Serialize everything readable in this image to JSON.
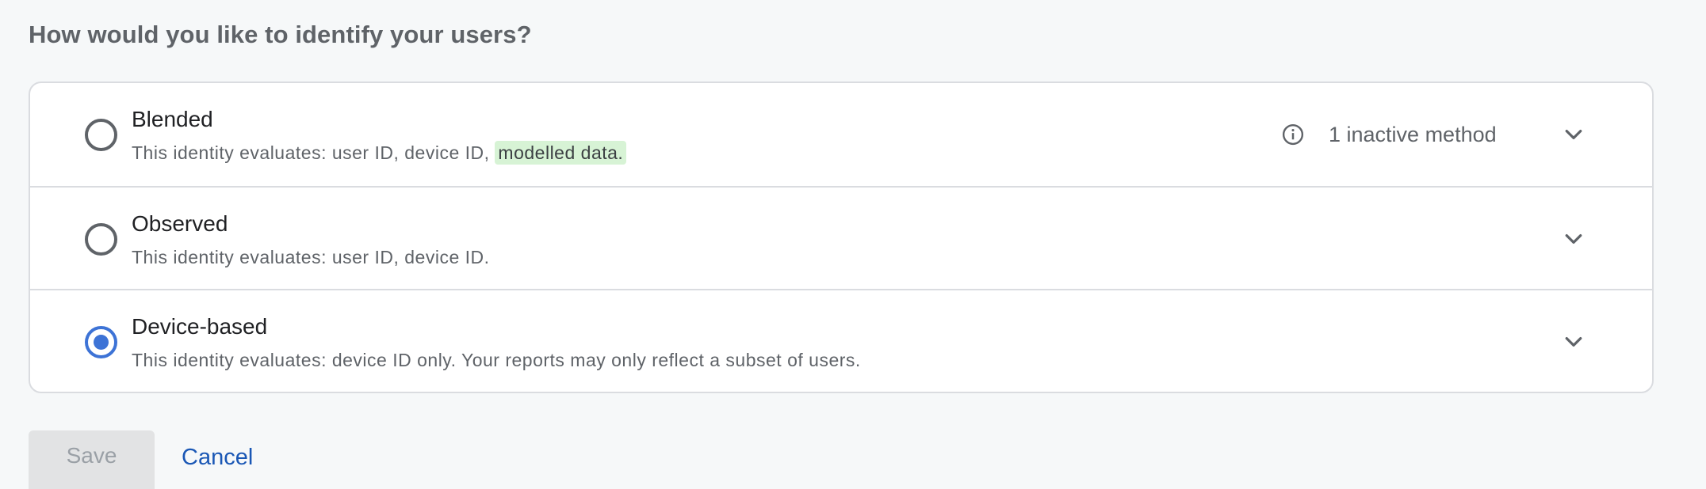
{
  "page": {
    "title": "How would you like to identify your users?"
  },
  "options": [
    {
      "title": "Blended",
      "description": "This identity evaluates: user ID, device ID, ",
      "highlight": "modelled data.",
      "badge": "1 inactive method",
      "badge_icon": "info-icon",
      "selected": false
    },
    {
      "title": "Observed",
      "description": "This identity evaluates: user ID, device ID.",
      "selected": false
    },
    {
      "title": "Device-based",
      "description": "This identity evaluates: device ID only. Your reports may only reflect a subset of users.",
      "selected": true
    }
  ],
  "actions": {
    "save_label": "Save",
    "cancel_label": "Cancel"
  },
  "colors": {
    "accent": "#3d73d6",
    "highlight_bg": "#d7f3d5",
    "link": "#1a57b5",
    "disabled_button_bg": "#e2e3e4"
  }
}
